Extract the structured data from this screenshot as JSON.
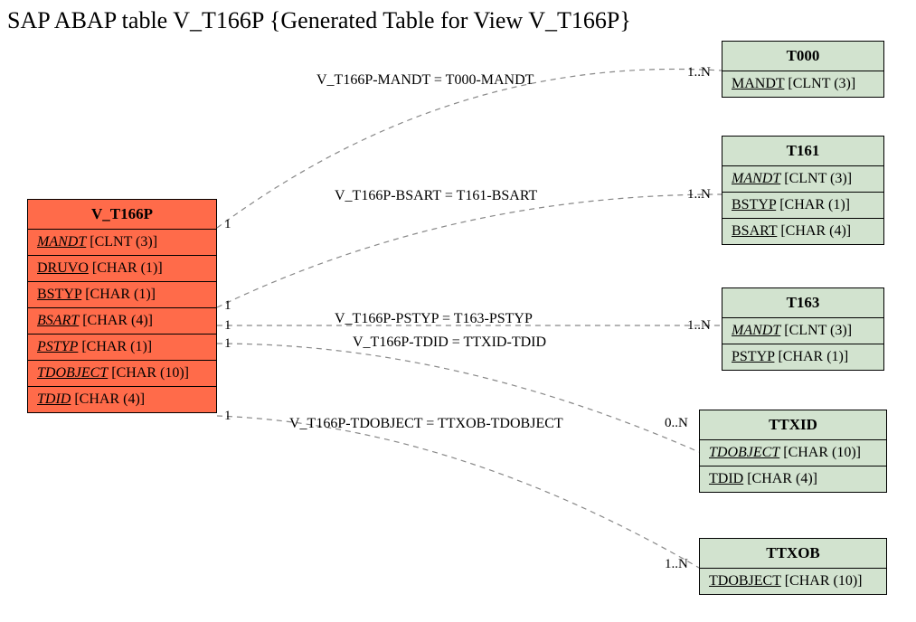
{
  "title": "SAP ABAP table V_T166P {Generated Table for View V_T166P}",
  "main_entity": {
    "name": "V_T166P",
    "fields": [
      {
        "name": "MANDT",
        "type": "[CLNT (3)]",
        "italic": true
      },
      {
        "name": "DRUVO",
        "type": "[CHAR (1)]",
        "italic": false
      },
      {
        "name": "BSTYP",
        "type": "[CHAR (1)]",
        "italic": false
      },
      {
        "name": "BSART",
        "type": "[CHAR (4)]",
        "italic": true
      },
      {
        "name": "PSTYP",
        "type": "[CHAR (1)]",
        "italic": true
      },
      {
        "name": "TDOBJECT",
        "type": "[CHAR (10)]",
        "italic": true
      },
      {
        "name": "TDID",
        "type": "[CHAR (4)]",
        "italic": true
      }
    ]
  },
  "related_entities": [
    {
      "name": "T000",
      "fields": [
        {
          "name": "MANDT",
          "type": "[CLNT (3)]",
          "italic": false
        }
      ]
    },
    {
      "name": "T161",
      "fields": [
        {
          "name": "MANDT",
          "type": "[CLNT (3)]",
          "italic": true
        },
        {
          "name": "BSTYP",
          "type": "[CHAR (1)]",
          "italic": false
        },
        {
          "name": "BSART",
          "type": "[CHAR (4)]",
          "italic": false
        }
      ]
    },
    {
      "name": "T163",
      "fields": [
        {
          "name": "MANDT",
          "type": "[CLNT (3)]",
          "italic": true
        },
        {
          "name": "PSTYP",
          "type": "[CHAR (1)]",
          "italic": false
        }
      ]
    },
    {
      "name": "TTXID",
      "fields": [
        {
          "name": "TDOBJECT",
          "type": "[CHAR (10)]",
          "italic": true
        },
        {
          "name": "TDID",
          "type": "[CHAR (4)]",
          "italic": false
        }
      ]
    },
    {
      "name": "TTXOB",
      "fields": [
        {
          "name": "TDOBJECT",
          "type": "[CHAR (10)]",
          "italic": false
        }
      ]
    }
  ],
  "relationships": [
    {
      "label": "V_T166P-MANDT = T000-MANDT",
      "left_card": "1",
      "right_card": "1..N"
    },
    {
      "label": "V_T166P-BSART = T161-BSART",
      "left_card": "1",
      "right_card": "1..N"
    },
    {
      "label": "V_T166P-PSTYP = T163-PSTYP",
      "left_card": "1",
      "right_card": "1..N"
    },
    {
      "label": "V_T166P-TDID = TTXID-TDID",
      "left_card": "1",
      "right_card": "0..N"
    },
    {
      "label": "V_T166P-TDOBJECT = TTXOB-TDOBJECT",
      "left_card": "1",
      "right_card": "1..N"
    }
  ]
}
